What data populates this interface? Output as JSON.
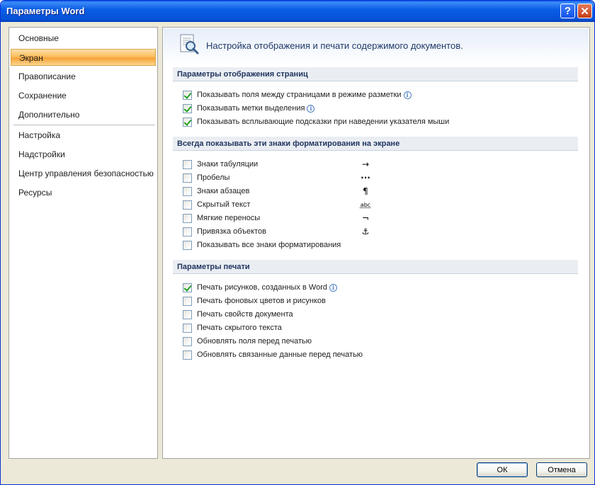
{
  "window": {
    "title": "Параметры Word",
    "help_label": "?",
    "close_label": "✕"
  },
  "nav": {
    "items": [
      {
        "label": "Основные"
      },
      {
        "label": "Экран"
      },
      {
        "label": "Правописание"
      },
      {
        "label": "Сохранение"
      },
      {
        "label": "Дополнительно"
      },
      {
        "label": "Настройка"
      },
      {
        "label": "Надстройки"
      },
      {
        "label": "Центр управления безопасностью"
      },
      {
        "label": "Ресурсы"
      }
    ],
    "selected": "Экран"
  },
  "header": {
    "icon": "document-magnifier-icon",
    "text": "Настройка отображения и печати содержимого документов."
  },
  "sections": [
    {
      "title": "Параметры отображения страниц",
      "options": [
        {
          "label": "Показывать поля между страницами в режиме разметки",
          "checked": true,
          "info": true
        },
        {
          "label": "Показывать метки выделения",
          "checked": true,
          "info": true
        },
        {
          "label": "Показывать всплывающие подсказки при наведении указателя мыши",
          "checked": true,
          "info": false
        }
      ]
    },
    {
      "title": "Всегда показывать эти знаки форматирования на экране",
      "options": [
        {
          "label": "Знаки табуляции",
          "checked": false,
          "symbol": "→"
        },
        {
          "label": "Пробелы",
          "checked": false,
          "symbol": "···"
        },
        {
          "label": "Знаки абзацев",
          "checked": false,
          "symbol": "¶"
        },
        {
          "label": "Скрытый текст",
          "checked": false,
          "symbol": "abc"
        },
        {
          "label": "Мягкие переносы",
          "checked": false,
          "symbol": "¬"
        },
        {
          "label": "Привязка объектов",
          "checked": false,
          "symbol": "⚓"
        },
        {
          "label": "Показывать все знаки форматирования",
          "checked": false
        }
      ]
    },
    {
      "title": "Параметры печати",
      "options": [
        {
          "label": "Печать рисунков, созданных в Word",
          "checked": true,
          "info": true
        },
        {
          "label": "Печать фоновых цветов и рисунков",
          "checked": false
        },
        {
          "label": "Печать свойств документа",
          "checked": false
        },
        {
          "label": "Печать скрытого текста",
          "checked": false
        },
        {
          "label": "Обновлять поля перед печатью",
          "checked": false
        },
        {
          "label": "Обновлять связанные данные перед печатью",
          "checked": false
        }
      ]
    }
  ],
  "buttons": {
    "ok": "ОК",
    "cancel": "Отмена"
  },
  "colors": {
    "titlebar": "#0b5ee7",
    "nav_selected": "#fbbe5d",
    "check": "#21a121"
  }
}
